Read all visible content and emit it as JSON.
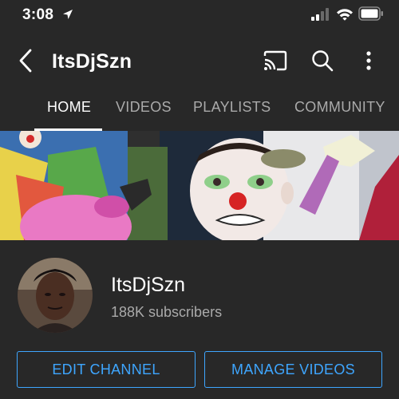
{
  "status_bar": {
    "time": "3:08"
  },
  "app_bar": {
    "title": "ItsDjSzn"
  },
  "tabs": [
    {
      "label": "HOME",
      "active": true
    },
    {
      "label": "VIDEOS",
      "active": false
    },
    {
      "label": "PLAYLISTS",
      "active": false
    },
    {
      "label": "COMMUNITY",
      "active": false
    }
  ],
  "channel": {
    "name": "ItsDjSzn",
    "subscribers": "188K subscribers"
  },
  "buttons": {
    "edit": "EDIT CHANNEL",
    "manage": "MANAGE VIDEOS"
  },
  "icons": {
    "location": "location-arrow-icon",
    "signal": "cellular-signal-icon",
    "wifi": "wifi-icon",
    "battery": "battery-icon",
    "back": "chevron-left-icon",
    "cast": "cast-icon",
    "search": "search-icon",
    "more": "more-vertical-icon"
  },
  "colors": {
    "background": "#282828",
    "accent_blue": "#3ea6ff",
    "secondary_text": "#aaaaaa"
  }
}
